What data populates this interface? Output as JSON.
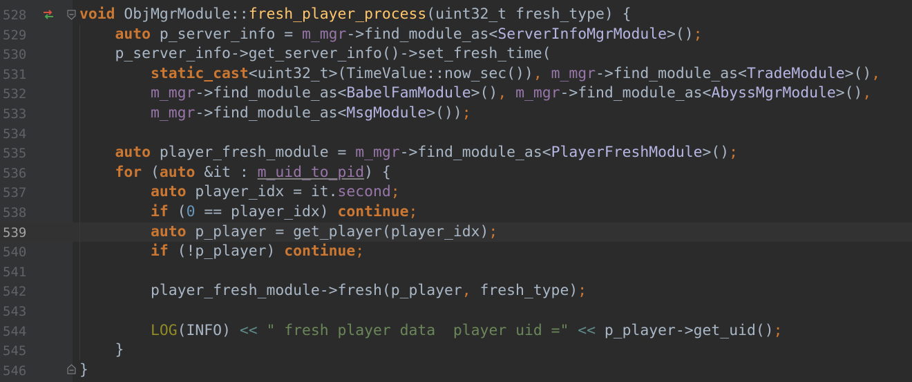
{
  "editor": {
    "current_line": "539",
    "lines": [
      {
        "num": "528",
        "tokens": [
          {
            "t": "void",
            "c": "kw"
          },
          {
            "t": " ObjMgrModule::",
            "c": "plain"
          },
          {
            "t": "fresh_player_process",
            "c": "fn"
          },
          {
            "t": "(uint32_t fresh_type) {",
            "c": "plain"
          }
        ]
      },
      {
        "num": "529",
        "tokens": [
          {
            "t": "    ",
            "c": "plain"
          },
          {
            "t": "auto",
            "c": "kw"
          },
          {
            "t": " p_server_info = ",
            "c": "plain"
          },
          {
            "t": "m_mgr",
            "c": "member"
          },
          {
            "t": "->find_module_as<",
            "c": "plain"
          },
          {
            "t": "ServerInfoMgrModule",
            "c": "cls"
          },
          {
            "t": ">()",
            "c": "plain"
          },
          {
            "t": ";",
            "c": "punct"
          }
        ]
      },
      {
        "num": "530",
        "tokens": [
          {
            "t": "    p_server_info->get_server_info()->set_fresh_time(",
            "c": "plain"
          }
        ]
      },
      {
        "num": "531",
        "tokens": [
          {
            "t": "        ",
            "c": "plain"
          },
          {
            "t": "static_cast",
            "c": "kw"
          },
          {
            "t": "<uint32_t>(TimeValue::now_sec())",
            "c": "plain"
          },
          {
            "t": ",",
            "c": "punct"
          },
          {
            "t": " ",
            "c": "plain"
          },
          {
            "t": "m_mgr",
            "c": "member"
          },
          {
            "t": "->find_module_as<",
            "c": "plain"
          },
          {
            "t": "TradeModule",
            "c": "cls"
          },
          {
            "t": ">()",
            "c": "plain"
          },
          {
            "t": ",",
            "c": "punct"
          }
        ]
      },
      {
        "num": "532",
        "tokens": [
          {
            "t": "        ",
            "c": "plain"
          },
          {
            "t": "m_mgr",
            "c": "member"
          },
          {
            "t": "->find_module_as<",
            "c": "plain"
          },
          {
            "t": "BabelFamModule",
            "c": "cls"
          },
          {
            "t": ">()",
            "c": "plain"
          },
          {
            "t": ",",
            "c": "punct"
          },
          {
            "t": " ",
            "c": "plain"
          },
          {
            "t": "m_mgr",
            "c": "member"
          },
          {
            "t": "->find_module_as<",
            "c": "plain"
          },
          {
            "t": "AbyssMgrModule",
            "c": "cls"
          },
          {
            "t": ">()",
            "c": "plain"
          },
          {
            "t": ",",
            "c": "punct"
          }
        ]
      },
      {
        "num": "533",
        "tokens": [
          {
            "t": "        ",
            "c": "plain"
          },
          {
            "t": "m_mgr",
            "c": "member"
          },
          {
            "t": "->find_module_as<",
            "c": "plain"
          },
          {
            "t": "MsgModule",
            "c": "cls"
          },
          {
            "t": ">())",
            "c": "plain"
          },
          {
            "t": ";",
            "c": "punct"
          }
        ]
      },
      {
        "num": "534",
        "tokens": []
      },
      {
        "num": "535",
        "tokens": [
          {
            "t": "    ",
            "c": "plain"
          },
          {
            "t": "auto",
            "c": "kw"
          },
          {
            "t": " player_fresh_module = ",
            "c": "plain"
          },
          {
            "t": "m_mgr",
            "c": "member"
          },
          {
            "t": "->find_module_as<",
            "c": "plain"
          },
          {
            "t": "PlayerFreshModule",
            "c": "cls"
          },
          {
            "t": ">()",
            "c": "plain"
          },
          {
            "t": ";",
            "c": "punct"
          }
        ]
      },
      {
        "num": "536",
        "tokens": [
          {
            "t": "    ",
            "c": "plain"
          },
          {
            "t": "for",
            "c": "kw"
          },
          {
            "t": " (",
            "c": "plain"
          },
          {
            "t": "auto",
            "c": "kw"
          },
          {
            "t": " &it : ",
            "c": "plain"
          },
          {
            "t": "m_uid_to_pid",
            "c": "member-u"
          },
          {
            "t": ") {",
            "c": "plain"
          }
        ]
      },
      {
        "num": "537",
        "tokens": [
          {
            "t": "        ",
            "c": "plain"
          },
          {
            "t": "auto",
            "c": "kw"
          },
          {
            "t": " player_idx = it.",
            "c": "plain"
          },
          {
            "t": "second",
            "c": "member"
          },
          {
            "t": ";",
            "c": "punct"
          }
        ]
      },
      {
        "num": "538",
        "tokens": [
          {
            "t": "        ",
            "c": "plain"
          },
          {
            "t": "if",
            "c": "kw"
          },
          {
            "t": " (",
            "c": "plain"
          },
          {
            "t": "0",
            "c": "num"
          },
          {
            "t": " == player_idx) ",
            "c": "plain"
          },
          {
            "t": "continue",
            "c": "kw"
          },
          {
            "t": ";",
            "c": "punct"
          }
        ]
      },
      {
        "num": "539",
        "tokens": [
          {
            "t": "        ",
            "c": "plain"
          },
          {
            "t": "auto",
            "c": "kw"
          },
          {
            "t": " p_player = get_player(player_idx)",
            "c": "plain"
          },
          {
            "t": ";",
            "c": "punct"
          }
        ]
      },
      {
        "num": "540",
        "tokens": [
          {
            "t": "        ",
            "c": "plain"
          },
          {
            "t": "if",
            "c": "kw"
          },
          {
            "t": " (!p_player) ",
            "c": "plain"
          },
          {
            "t": "continue",
            "c": "kw"
          },
          {
            "t": ";",
            "c": "punct"
          }
        ]
      },
      {
        "num": "541",
        "tokens": []
      },
      {
        "num": "542",
        "tokens": [
          {
            "t": "        player_fresh_module->fresh(p_player",
            "c": "plain"
          },
          {
            "t": ",",
            "c": "punct"
          },
          {
            "t": " fresh_type)",
            "c": "plain"
          },
          {
            "t": ";",
            "c": "punct"
          }
        ]
      },
      {
        "num": "543",
        "tokens": []
      },
      {
        "num": "544",
        "tokens": [
          {
            "t": "        ",
            "c": "plain"
          },
          {
            "t": "LOG",
            "c": "macro"
          },
          {
            "t": "(INFO) ",
            "c": "plain"
          },
          {
            "t": "<<",
            "c": "op"
          },
          {
            "t": " ",
            "c": "plain"
          },
          {
            "t": "\" fresh player data  player uid =\"",
            "c": "str"
          },
          {
            "t": " ",
            "c": "plain"
          },
          {
            "t": "<<",
            "c": "op"
          },
          {
            "t": " p_player->get_uid()",
            "c": "plain"
          },
          {
            "t": ";",
            "c": "punct"
          }
        ]
      },
      {
        "num": "545",
        "tokens": [
          {
            "t": "    }",
            "c": "plain"
          }
        ]
      },
      {
        "num": "546",
        "tokens": [
          {
            "t": "}",
            "c": "plain"
          }
        ]
      }
    ]
  }
}
